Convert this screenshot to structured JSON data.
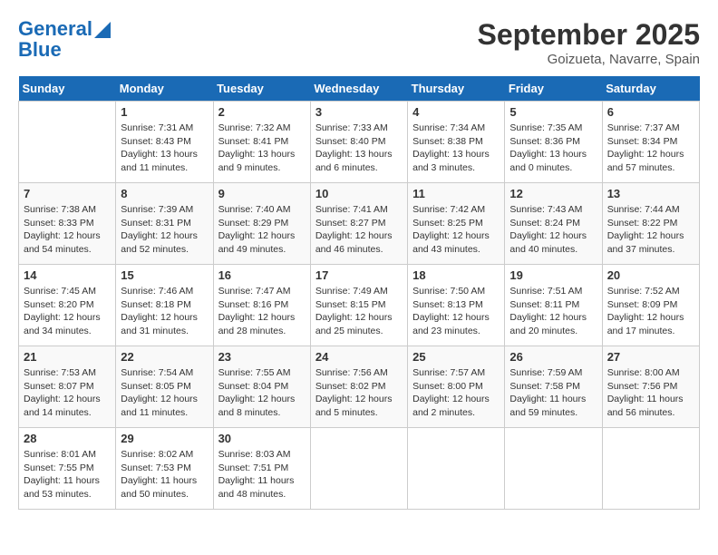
{
  "header": {
    "logo_line1": "General",
    "logo_line2": "Blue",
    "month": "September 2025",
    "location": "Goizueta, Navarre, Spain"
  },
  "weekdays": [
    "Sunday",
    "Monday",
    "Tuesday",
    "Wednesday",
    "Thursday",
    "Friday",
    "Saturday"
  ],
  "weeks": [
    [
      {
        "day": "",
        "info": ""
      },
      {
        "day": "1",
        "info": "Sunrise: 7:31 AM\nSunset: 8:43 PM\nDaylight: 13 hours\nand 11 minutes."
      },
      {
        "day": "2",
        "info": "Sunrise: 7:32 AM\nSunset: 8:41 PM\nDaylight: 13 hours\nand 9 minutes."
      },
      {
        "day": "3",
        "info": "Sunrise: 7:33 AM\nSunset: 8:40 PM\nDaylight: 13 hours\nand 6 minutes."
      },
      {
        "day": "4",
        "info": "Sunrise: 7:34 AM\nSunset: 8:38 PM\nDaylight: 13 hours\nand 3 minutes."
      },
      {
        "day": "5",
        "info": "Sunrise: 7:35 AM\nSunset: 8:36 PM\nDaylight: 13 hours\nand 0 minutes."
      },
      {
        "day": "6",
        "info": "Sunrise: 7:37 AM\nSunset: 8:34 PM\nDaylight: 12 hours\nand 57 minutes."
      }
    ],
    [
      {
        "day": "7",
        "info": "Sunrise: 7:38 AM\nSunset: 8:33 PM\nDaylight: 12 hours\nand 54 minutes."
      },
      {
        "day": "8",
        "info": "Sunrise: 7:39 AM\nSunset: 8:31 PM\nDaylight: 12 hours\nand 52 minutes."
      },
      {
        "day": "9",
        "info": "Sunrise: 7:40 AM\nSunset: 8:29 PM\nDaylight: 12 hours\nand 49 minutes."
      },
      {
        "day": "10",
        "info": "Sunrise: 7:41 AM\nSunset: 8:27 PM\nDaylight: 12 hours\nand 46 minutes."
      },
      {
        "day": "11",
        "info": "Sunrise: 7:42 AM\nSunset: 8:25 PM\nDaylight: 12 hours\nand 43 minutes."
      },
      {
        "day": "12",
        "info": "Sunrise: 7:43 AM\nSunset: 8:24 PM\nDaylight: 12 hours\nand 40 minutes."
      },
      {
        "day": "13",
        "info": "Sunrise: 7:44 AM\nSunset: 8:22 PM\nDaylight: 12 hours\nand 37 minutes."
      }
    ],
    [
      {
        "day": "14",
        "info": "Sunrise: 7:45 AM\nSunset: 8:20 PM\nDaylight: 12 hours\nand 34 minutes."
      },
      {
        "day": "15",
        "info": "Sunrise: 7:46 AM\nSunset: 8:18 PM\nDaylight: 12 hours\nand 31 minutes."
      },
      {
        "day": "16",
        "info": "Sunrise: 7:47 AM\nSunset: 8:16 PM\nDaylight: 12 hours\nand 28 minutes."
      },
      {
        "day": "17",
        "info": "Sunrise: 7:49 AM\nSunset: 8:15 PM\nDaylight: 12 hours\nand 25 minutes."
      },
      {
        "day": "18",
        "info": "Sunrise: 7:50 AM\nSunset: 8:13 PM\nDaylight: 12 hours\nand 23 minutes."
      },
      {
        "day": "19",
        "info": "Sunrise: 7:51 AM\nSunset: 8:11 PM\nDaylight: 12 hours\nand 20 minutes."
      },
      {
        "day": "20",
        "info": "Sunrise: 7:52 AM\nSunset: 8:09 PM\nDaylight: 12 hours\nand 17 minutes."
      }
    ],
    [
      {
        "day": "21",
        "info": "Sunrise: 7:53 AM\nSunset: 8:07 PM\nDaylight: 12 hours\nand 14 minutes."
      },
      {
        "day": "22",
        "info": "Sunrise: 7:54 AM\nSunset: 8:05 PM\nDaylight: 12 hours\nand 11 minutes."
      },
      {
        "day": "23",
        "info": "Sunrise: 7:55 AM\nSunset: 8:04 PM\nDaylight: 12 hours\nand 8 minutes."
      },
      {
        "day": "24",
        "info": "Sunrise: 7:56 AM\nSunset: 8:02 PM\nDaylight: 12 hours\nand 5 minutes."
      },
      {
        "day": "25",
        "info": "Sunrise: 7:57 AM\nSunset: 8:00 PM\nDaylight: 12 hours\nand 2 minutes."
      },
      {
        "day": "26",
        "info": "Sunrise: 7:59 AM\nSunset: 7:58 PM\nDaylight: 11 hours\nand 59 minutes."
      },
      {
        "day": "27",
        "info": "Sunrise: 8:00 AM\nSunset: 7:56 PM\nDaylight: 11 hours\nand 56 minutes."
      }
    ],
    [
      {
        "day": "28",
        "info": "Sunrise: 8:01 AM\nSunset: 7:55 PM\nDaylight: 11 hours\nand 53 minutes."
      },
      {
        "day": "29",
        "info": "Sunrise: 8:02 AM\nSunset: 7:53 PM\nDaylight: 11 hours\nand 50 minutes."
      },
      {
        "day": "30",
        "info": "Sunrise: 8:03 AM\nSunset: 7:51 PM\nDaylight: 11 hours\nand 48 minutes."
      },
      {
        "day": "",
        "info": ""
      },
      {
        "day": "",
        "info": ""
      },
      {
        "day": "",
        "info": ""
      },
      {
        "day": "",
        "info": ""
      }
    ]
  ]
}
